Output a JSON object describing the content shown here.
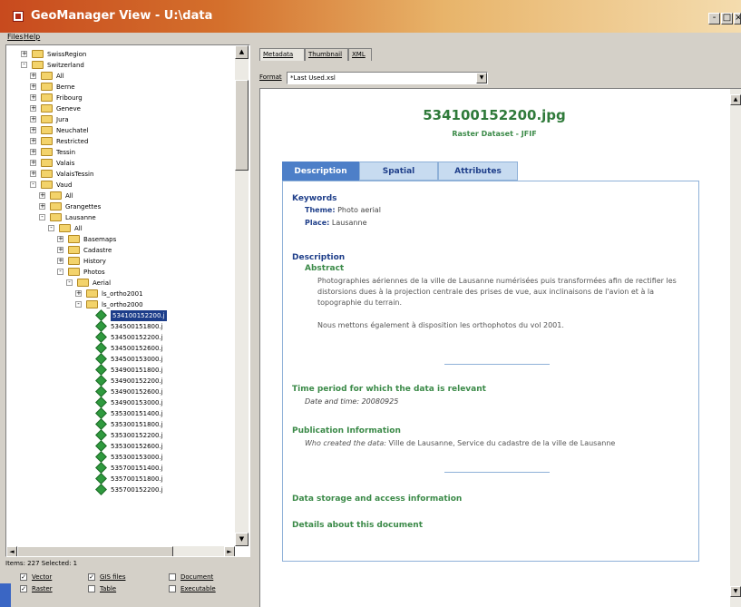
{
  "window": {
    "title": "GeoManager View - U:\\data",
    "controls": [
      "-",
      "□",
      "×"
    ]
  },
  "menu": [
    {
      "label": "Files"
    },
    {
      "label": "Help"
    }
  ],
  "tree": {
    "items": [
      {
        "label": "SwissRegion",
        "toggle": "+",
        "icon": "folder"
      },
      {
        "label": "Switzerland",
        "toggle": "-",
        "icon": "folder"
      },
      {
        "label": "All",
        "toggle": "+",
        "icon": "folder"
      },
      {
        "label": "Berne",
        "toggle": "+",
        "icon": "folder"
      },
      {
        "label": "Fribourg",
        "toggle": "+",
        "icon": "folder"
      },
      {
        "label": "Geneve",
        "toggle": "+",
        "icon": "folder"
      },
      {
        "label": "Jura",
        "toggle": "+",
        "icon": "folder"
      },
      {
        "label": "Neuchatel",
        "toggle": "+",
        "icon": "folder"
      },
      {
        "label": "Restricted",
        "toggle": "+",
        "icon": "folder"
      },
      {
        "label": "Tessin",
        "toggle": "+",
        "icon": "folder"
      },
      {
        "label": "Valais",
        "toggle": "+",
        "icon": "folder"
      },
      {
        "label": "ValaisTessin",
        "toggle": "+",
        "icon": "folder"
      },
      {
        "label": "Vaud",
        "toggle": "-",
        "icon": "folder"
      },
      {
        "label": "All",
        "toggle": "+",
        "icon": "folder"
      },
      {
        "label": "Grangettes",
        "toggle": "+",
        "icon": "folder"
      },
      {
        "label": "Lausanne",
        "toggle": "-",
        "icon": "folder"
      },
      {
        "label": "All",
        "toggle": "-",
        "icon": "folder"
      },
      {
        "label": "Basemaps",
        "toggle": "+",
        "icon": "folder"
      },
      {
        "label": "Cadastre",
        "toggle": "+",
        "icon": "folder"
      },
      {
        "label": "History",
        "toggle": "+",
        "icon": "folder"
      },
      {
        "label": "Photos",
        "toggle": "-",
        "icon": "folder"
      },
      {
        "label": "Aerial",
        "toggle": "-",
        "icon": "folder"
      },
      {
        "label": "ls_ortho2001",
        "toggle": "+",
        "icon": "folder"
      },
      {
        "label": "ls_ortho2000",
        "toggle": "-",
        "icon": "folder"
      },
      {
        "label": "534100152200.j",
        "toggle": "",
        "icon": "file",
        "selected": true
      },
      {
        "label": "534500151800.j",
        "toggle": "",
        "icon": "file"
      },
      {
        "label": "534500152200.j",
        "toggle": "",
        "icon": "file"
      },
      {
        "label": "534500152600.j",
        "toggle": "",
        "icon": "file"
      },
      {
        "label": "534500153000.j",
        "toggle": "",
        "icon": "file"
      },
      {
        "label": "534900151800.j",
        "toggle": "",
        "icon": "file"
      },
      {
        "label": "534900152200.j",
        "toggle": "",
        "icon": "file"
      },
      {
        "label": "534900152600.j",
        "toggle": "",
        "icon": "file"
      },
      {
        "label": "534900153000.j",
        "toggle": "",
        "icon": "file"
      },
      {
        "label": "535300151400.j",
        "toggle": "",
        "icon": "file"
      },
      {
        "label": "535300151800.j",
        "toggle": "",
        "icon": "file"
      },
      {
        "label": "535300152200.j",
        "toggle": "",
        "icon": "file"
      },
      {
        "label": "535300152600.j",
        "toggle": "",
        "icon": "file"
      },
      {
        "label": "535300153000.j",
        "toggle": "",
        "icon": "file"
      },
      {
        "label": "535700151400.j",
        "toggle": "",
        "icon": "file"
      },
      {
        "label": "535700151800.j",
        "toggle": "",
        "icon": "file"
      },
      {
        "label": "535700152200.j",
        "toggle": "",
        "icon": "file"
      }
    ]
  },
  "status": {
    "text": "Items: 227 Selected: 1"
  },
  "filters": [
    {
      "label": "Vector",
      "checked": true
    },
    {
      "label": "GIS files",
      "checked": true
    },
    {
      "label": "Document",
      "checked": false
    },
    {
      "label": "Raster",
      "checked": true
    },
    {
      "label": "Table",
      "checked": false
    },
    {
      "label": "Executable",
      "checked": false
    }
  ],
  "viewer_tabs": [
    {
      "label": "Metadata",
      "active": true
    },
    {
      "label": "Thumbnail",
      "active": false
    },
    {
      "label": "XML",
      "active": false
    }
  ],
  "format": {
    "label": "Format",
    "value": "*Last Used.xsl"
  },
  "metadata": {
    "title": "534100152200.jpg",
    "subtitle": "Raster Dataset - JFIF",
    "tabs": [
      {
        "label": "Description",
        "active": true
      },
      {
        "label": "Spatial",
        "active": false
      },
      {
        "label": "Attributes",
        "active": false
      }
    ],
    "keywords_heading": "Keywords",
    "theme_key": "Theme:",
    "theme_value": "Photo aerial",
    "place_key": "Place:",
    "place_value": "Lausanne",
    "description_heading": "Description",
    "abstract_heading": "Abstract",
    "abstract_text": "Photographies aériennes de la ville de Lausanne numérisées puis transformées afin de rectifier les distorsions dues à la projection centrale des prises de vue, aux inclinaisons de l'avion et à la topographie du terrain.",
    "abstract_text2": "Nous mettons également à disposition les orthophotos du vol 2001.",
    "time_heading": "Time period for which the data is relevant",
    "time_key": "Date and time:",
    "time_value": "20080925",
    "pub_heading": "Publication Information",
    "pub_key": "Who created the data:",
    "pub_value": "Ville de Lausanne, Service du cadastre de la ville de Lausanne",
    "storage_heading": "Data storage and access information",
    "details_heading": "Details about this document"
  }
}
